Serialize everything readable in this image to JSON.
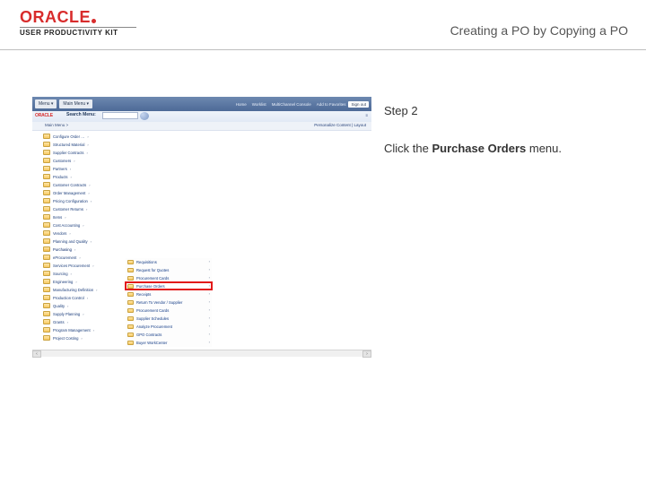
{
  "header": {
    "brand": "ORACLE",
    "subbrand": "USER PRODUCTIVITY KIT",
    "title": "Creating a PO by Copying a PO"
  },
  "instruction": {
    "step_label": "Step 2",
    "text_before": "Click the ",
    "text_bold": "Purchase Orders",
    "text_after": " menu."
  },
  "app": {
    "topbar": {
      "menu_btn": "Menu ▾",
      "main_label": "Main Menu ▾",
      "links": [
        "Home",
        "Worklist",
        "MultiChannel Console",
        "Add to Favorites"
      ],
      "signout": "Sign out"
    },
    "search": {
      "brand": "ORACLE",
      "label": "Search Menu:",
      "collapse": "≡"
    },
    "subhead": {
      "left": "Main Menu >",
      "right": "Personalize Content | Layout"
    },
    "tree": [
      "Configure Order …",
      "Structured Material",
      "Supplier Contracts",
      "Customers",
      "Partners",
      "Products",
      "Customer Contracts",
      "Order Management",
      "Pricing Configuration",
      "Customer Returns",
      "Items",
      "Cost Accounting",
      "Vendors",
      "Planning and Quality",
      "Purchasing",
      "eProcurement",
      "Services Procurement",
      "Sourcing",
      "Engineering",
      "Manufacturing Definition",
      "Production Control",
      "Quality",
      "Supply Planning",
      "Grants",
      "Program Management",
      "Project Costing"
    ],
    "selected_index": 14,
    "submenu": [
      "Requisitions",
      "Request for Quotes",
      "Procurement Cards",
      "Purchase Orders",
      "Receipts",
      "Return To Vendor / Supplier",
      "Procurement Cards",
      "Supplier Schedules",
      "Analyze Procurement",
      "GPO Contracts",
      "Buyer WorkCenter"
    ],
    "highlight_index": 3
  }
}
